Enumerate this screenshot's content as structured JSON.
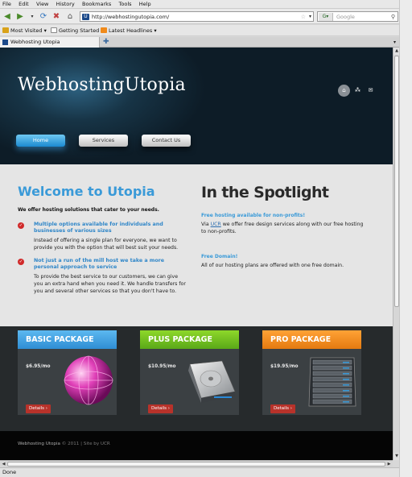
{
  "browser": {
    "menu": [
      "File",
      "Edit",
      "View",
      "History",
      "Bookmarks",
      "Tools",
      "Help"
    ],
    "url": "http://webhostingutopia.com/",
    "search_placeholder": "Google",
    "bookmarks": [
      "Most Visited",
      "Getting Started",
      "Latest Headlines"
    ],
    "tab_title": "Webhosting Utopia",
    "status": "Done"
  },
  "site": {
    "logo": "WebhostingUtopia",
    "nav": [
      "Home",
      "Services",
      "Contact Us"
    ],
    "welcome": {
      "title": "Welcome to Utopia",
      "intro": "We offer hosting solutions that cater to your needs.",
      "features": [
        {
          "title": "Multiple options available for individuals and businesses of various sizes",
          "body": "Instead of offering a single plan for everyone, we want to provide you with the option that will best suit your needs."
        },
        {
          "title": "Not just a run of the mill host we take a more personal approach to service",
          "body": "To provide the best service to our customers, we can give you an extra hand when you need it. We handle transfers for you and several other services so that you don't have to."
        }
      ]
    },
    "spotlight": {
      "title": "In the Spotlight",
      "items": [
        {
          "title": "Free hosting available for non-profits!",
          "body_pre": "Via ",
          "link": "UCR",
          "body_post": " we offer free design services along with our free hosting to non-profits."
        },
        {
          "title": "Free Domain!",
          "body": "All of our hosting plans are offered with one free domain."
        }
      ]
    },
    "packages": [
      {
        "name": "BASIC PACKAGE",
        "price": "$6.95/mo",
        "details": "Details ›"
      },
      {
        "name": "PLUS PACKAGE",
        "price": "$10.95/mo",
        "details": "Details ›"
      },
      {
        "name": "PRO PACKAGE",
        "price": "$19.95/mo",
        "details": "Details ›"
      }
    ],
    "footer": {
      "brand": "Webhosting Utopia",
      "rest": " © 2011 | Site by UCR"
    }
  },
  "colors": {
    "accent_blue": "#3a9ad8",
    "basic": "#2f8ed4",
    "plus": "#5aa818",
    "pro": "#e47a10",
    "details_red": "#b8322a"
  }
}
